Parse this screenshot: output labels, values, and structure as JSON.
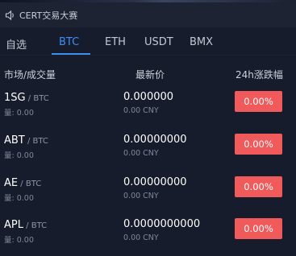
{
  "notice": {
    "text": "CERT交易大赛",
    "icon": "speaker-icon"
  },
  "tabs": [
    {
      "label": "自选",
      "active": false
    },
    {
      "label": "BTC",
      "active": true
    },
    {
      "label": "ETH",
      "active": false
    },
    {
      "label": "USDT",
      "active": false
    },
    {
      "label": "BMX",
      "active": false
    }
  ],
  "header": {
    "pair_volume": "市场/成交量",
    "last_price": "最新价",
    "change_24h": "24h涨跌幅"
  },
  "rows": [
    {
      "symbol": "1SG",
      "quote": " / BTC",
      "volume": "量: 0.00",
      "price": "0.000000",
      "cny": "0.00 CNY",
      "change": "0.00%"
    },
    {
      "symbol": "ABT",
      "quote": " / BTC",
      "volume": "量: 0.00",
      "price": "0.00000000",
      "cny": "0.00 CNY",
      "change": "0.00%"
    },
    {
      "symbol": "AE",
      "quote": " / BTC",
      "volume": "量: 0.00",
      "price": "0.00000000",
      "cny": "0.00 CNY",
      "change": "0.00%"
    },
    {
      "symbol": "APL",
      "quote": " / BTC",
      "volume": "量: 0.00",
      "price": "0.0000000000",
      "cny": "0.00 CNY",
      "change": "0.00%"
    }
  ],
  "colors": {
    "background": "#171c2c",
    "accent": "#3f8ef2",
    "change_badge": "#f05a5a"
  }
}
